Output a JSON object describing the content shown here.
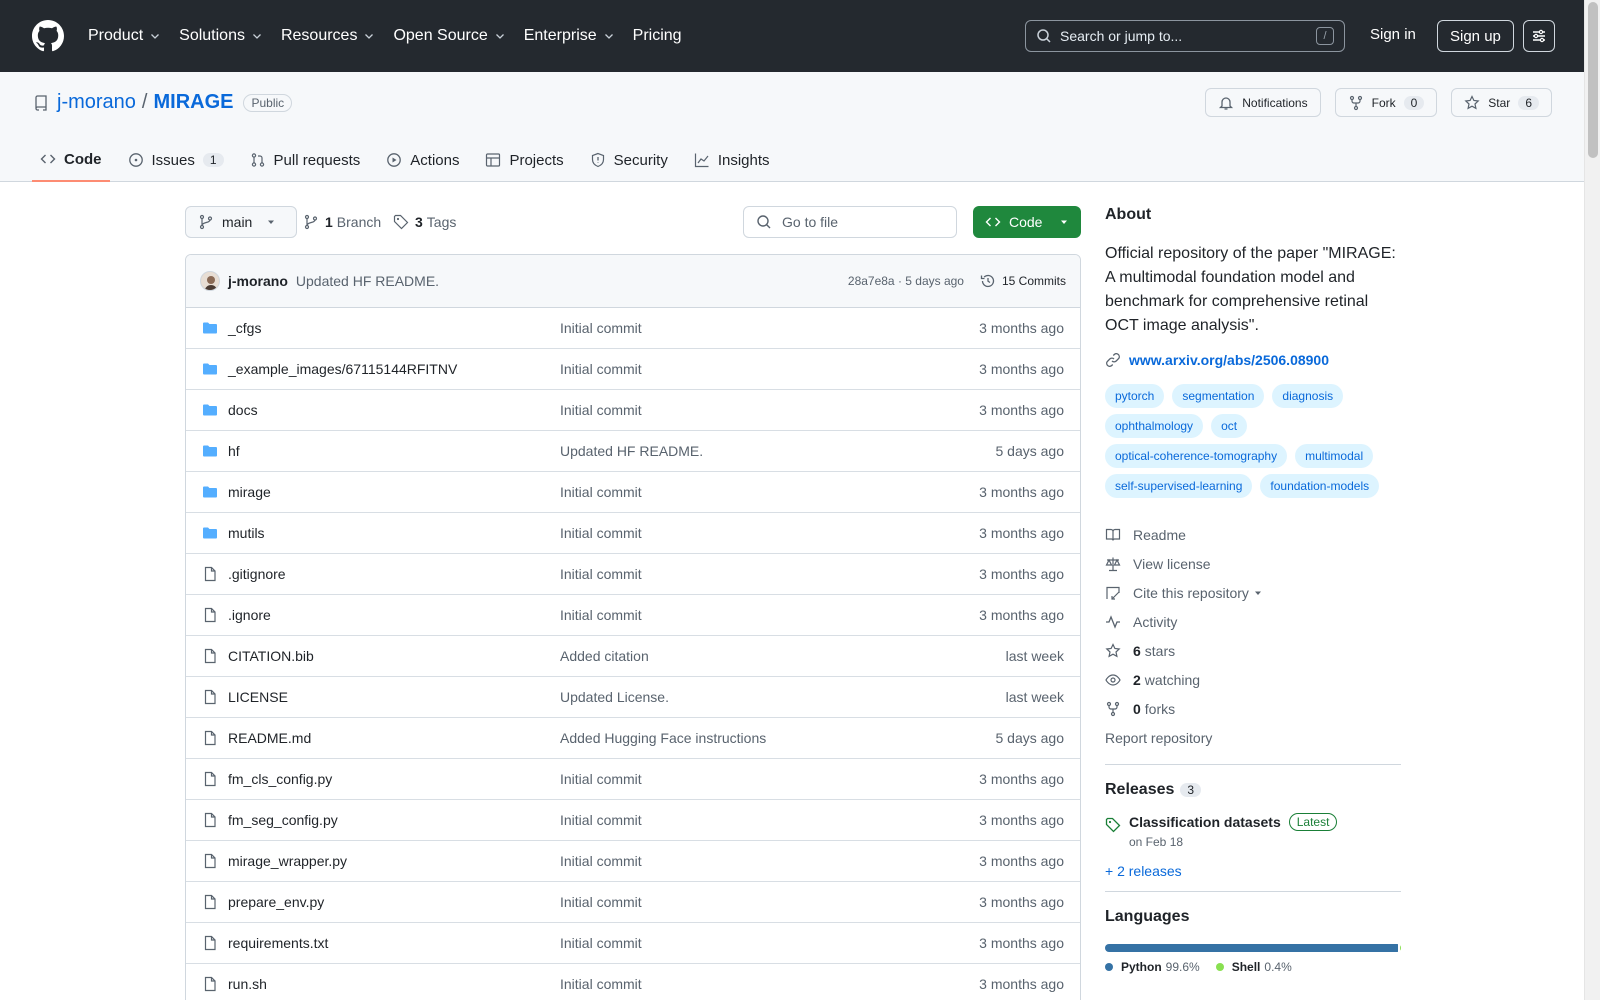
{
  "header": {
    "nav": [
      "Product",
      "Solutions",
      "Resources",
      "Open Source",
      "Enterprise",
      "Pricing"
    ],
    "search_placeholder": "Search or jump to...",
    "search_shortcut": "/",
    "sign_in": "Sign in",
    "sign_up": "Sign up"
  },
  "repo": {
    "owner": "j-morano",
    "separator": "/",
    "name": "MIRAGE",
    "visibility": "Public",
    "notifications_label": "Notifications",
    "fork_label": "Fork",
    "fork_count": "0",
    "star_label": "Star",
    "star_count": "6",
    "tabs": [
      {
        "label": "Code",
        "count": ""
      },
      {
        "label": "Issues",
        "count": "1"
      },
      {
        "label": "Pull requests",
        "count": ""
      },
      {
        "label": "Actions",
        "count": ""
      },
      {
        "label": "Projects",
        "count": ""
      },
      {
        "label": "Security",
        "count": ""
      },
      {
        "label": "Insights",
        "count": ""
      }
    ]
  },
  "branch": {
    "name": "main",
    "branch_count": "1",
    "branch_label": "Branch",
    "tag_count": "3",
    "tag_label": "Tags",
    "goto_placeholder": "Go to file",
    "code_button": "Code"
  },
  "commit": {
    "author": "j-morano",
    "message": "Updated HF README.",
    "hash_time": "28a7e8a · 5 days ago",
    "commits_label": "15 Commits"
  },
  "files": [
    {
      "type": "dir",
      "name": "_cfgs",
      "message": "Initial commit",
      "age": "3 months ago"
    },
    {
      "type": "dir",
      "name": "_example_images/67115144RFITNV",
      "message": "Initial commit",
      "age": "3 months ago"
    },
    {
      "type": "dir",
      "name": "docs",
      "message": "Initial commit",
      "age": "3 months ago"
    },
    {
      "type": "dir",
      "name": "hf",
      "message": "Updated HF README.",
      "age": "5 days ago"
    },
    {
      "type": "dir",
      "name": "mirage",
      "message": "Initial commit",
      "age": "3 months ago"
    },
    {
      "type": "dir",
      "name": "mutils",
      "message": "Initial commit",
      "age": "3 months ago"
    },
    {
      "type": "file",
      "name": ".gitignore",
      "message": "Initial commit",
      "age": "3 months ago"
    },
    {
      "type": "file",
      "name": ".ignore",
      "message": "Initial commit",
      "age": "3 months ago"
    },
    {
      "type": "file",
      "name": "CITATION.bib",
      "message": "Added citation",
      "age": "last week"
    },
    {
      "type": "file",
      "name": "LICENSE",
      "message": "Updated License.",
      "age": "last week"
    },
    {
      "type": "file",
      "name": "README.md",
      "message": "Added Hugging Face instructions",
      "age": "5 days ago"
    },
    {
      "type": "file",
      "name": "fm_cls_config.py",
      "message": "Initial commit",
      "age": "3 months ago"
    },
    {
      "type": "file",
      "name": "fm_seg_config.py",
      "message": "Initial commit",
      "age": "3 months ago"
    },
    {
      "type": "file",
      "name": "mirage_wrapper.py",
      "message": "Initial commit",
      "age": "3 months ago"
    },
    {
      "type": "file",
      "name": "prepare_env.py",
      "message": "Initial commit",
      "age": "3 months ago"
    },
    {
      "type": "file",
      "name": "requirements.txt",
      "message": "Initial commit",
      "age": "3 months ago"
    },
    {
      "type": "file",
      "name": "run.sh",
      "message": "Initial commit",
      "age": "3 months ago"
    }
  ],
  "about": {
    "title": "About",
    "description": "Official repository of the paper \"MIRAGE: A multimodal foundation model and benchmark for comprehensive retinal OCT image analysis\".",
    "link": "www.arxiv.org/abs/2506.08900",
    "topics": [
      "pytorch",
      "segmentation",
      "diagnosis",
      "ophthalmology",
      "oct",
      "optical-coherence-tomography",
      "multimodal",
      "self-supervised-learning",
      "foundation-models"
    ],
    "readme": "Readme",
    "license": "View license",
    "cite": "Cite this repository",
    "activity": "Activity",
    "stars_count": "6",
    "stars_label": "stars",
    "watching_count": "2",
    "watching_label": "watching",
    "forks_count": "0",
    "forks_label": "forks",
    "report": "Report repository"
  },
  "releases": {
    "title": "Releases",
    "count": "3",
    "latest_name": "Classification datasets",
    "latest_badge": "Latest",
    "latest_date": "on Feb 18",
    "more": "+ 2 releases"
  },
  "languages": {
    "title": "Languages",
    "items": [
      {
        "name": "Python",
        "percent": "99.6%",
        "value": 99.6,
        "color": "#3572A5"
      },
      {
        "name": "Shell",
        "percent": "0.4%",
        "value": 0.4,
        "color": "#89e051"
      }
    ]
  },
  "colors": {
    "header_bg": "#24292f",
    "link": "#0969da",
    "primary_button": "#1f883d",
    "folder": "#54aeff",
    "active_tab_underline": "#fd8c73"
  }
}
